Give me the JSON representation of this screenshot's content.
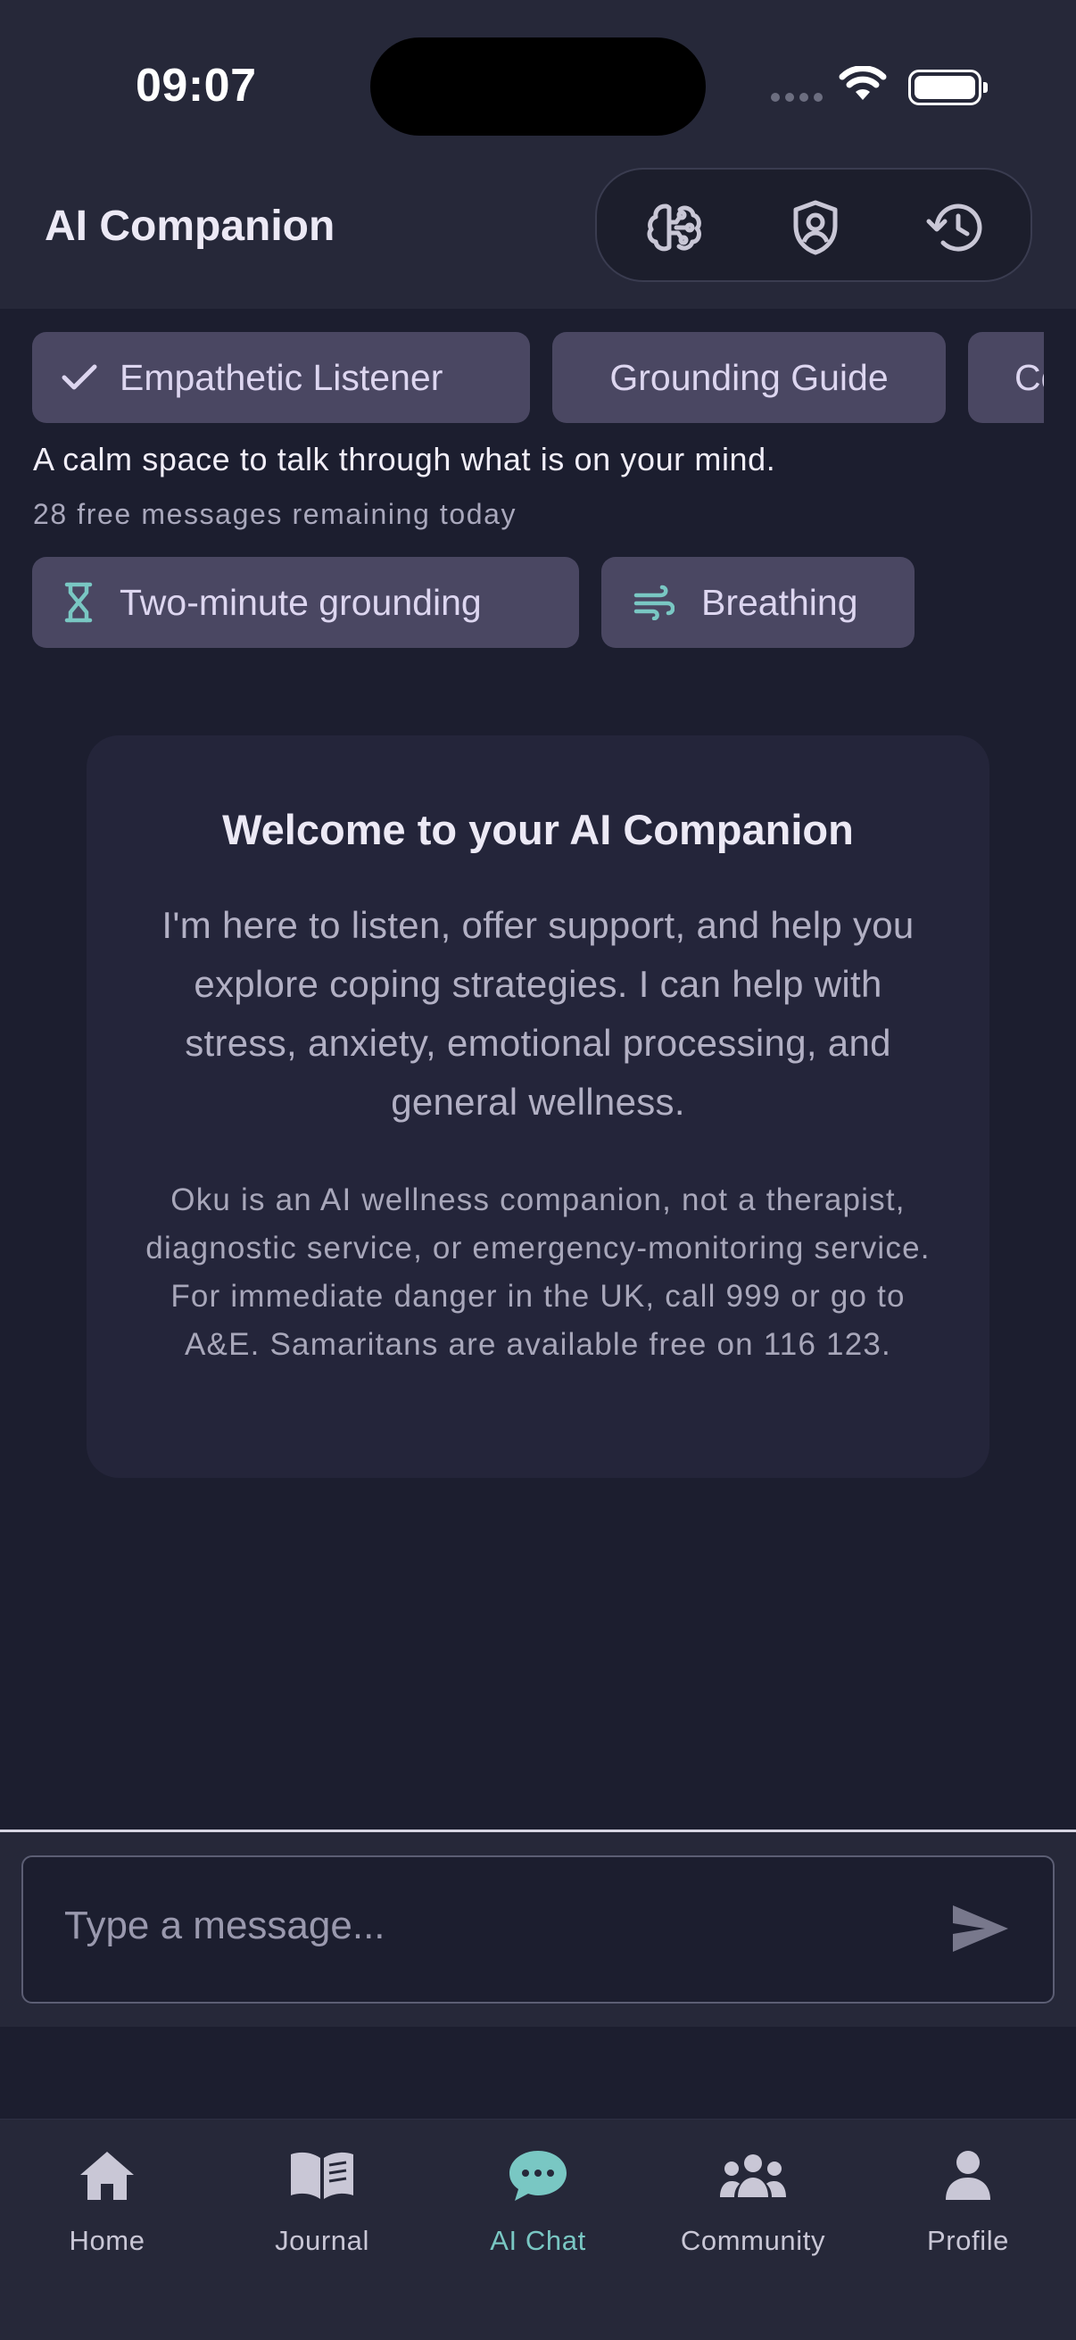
{
  "status_bar": {
    "time": "09:07"
  },
  "header": {
    "title": "AI Companion",
    "actions": [
      {
        "icon": "brain-icon"
      },
      {
        "icon": "shield-user-icon"
      },
      {
        "icon": "history-icon"
      }
    ]
  },
  "personas": {
    "items": [
      {
        "label": "Empathetic Listener",
        "selected": true
      },
      {
        "label": "Grounding Guide",
        "selected": false
      },
      {
        "label": "Co",
        "selected": false
      }
    ],
    "tagline": "A calm space to talk through what is on your mind.",
    "remaining": "28 free messages remaining today"
  },
  "tools": [
    {
      "label": "Two-minute grounding",
      "icon": "hourglass-icon"
    },
    {
      "label": "Breathing",
      "icon": "wind-icon"
    }
  ],
  "welcome": {
    "title": "Welcome to your AI Companion",
    "intro": "I'm here to listen, offer support, and help you explore coping strategies. I can help with stress, anxiety, emotional processing, and general wellness.",
    "disclaimer": "Oku is an AI wellness companion, not a therapist, diagnostic service, or emergency-monitoring service. For immediate danger in the UK, call 999 or go to A&E. Samaritans are available free on 116 123."
  },
  "composer": {
    "placeholder": "Type a message...",
    "value": ""
  },
  "nav": {
    "tabs": [
      {
        "label": "Home",
        "icon": "home-icon",
        "active": false
      },
      {
        "label": "Journal",
        "icon": "book-icon",
        "active": false
      },
      {
        "label": "AI Chat",
        "icon": "chat-icon",
        "active": true
      },
      {
        "label": "Community",
        "icon": "users-icon",
        "active": false
      },
      {
        "label": "Profile",
        "icon": "user-icon",
        "active": false
      }
    ]
  },
  "colors": {
    "background": "#1c1e2f",
    "surface": "#262839",
    "chip": "#4a4762",
    "accent": "#79c7c3"
  }
}
